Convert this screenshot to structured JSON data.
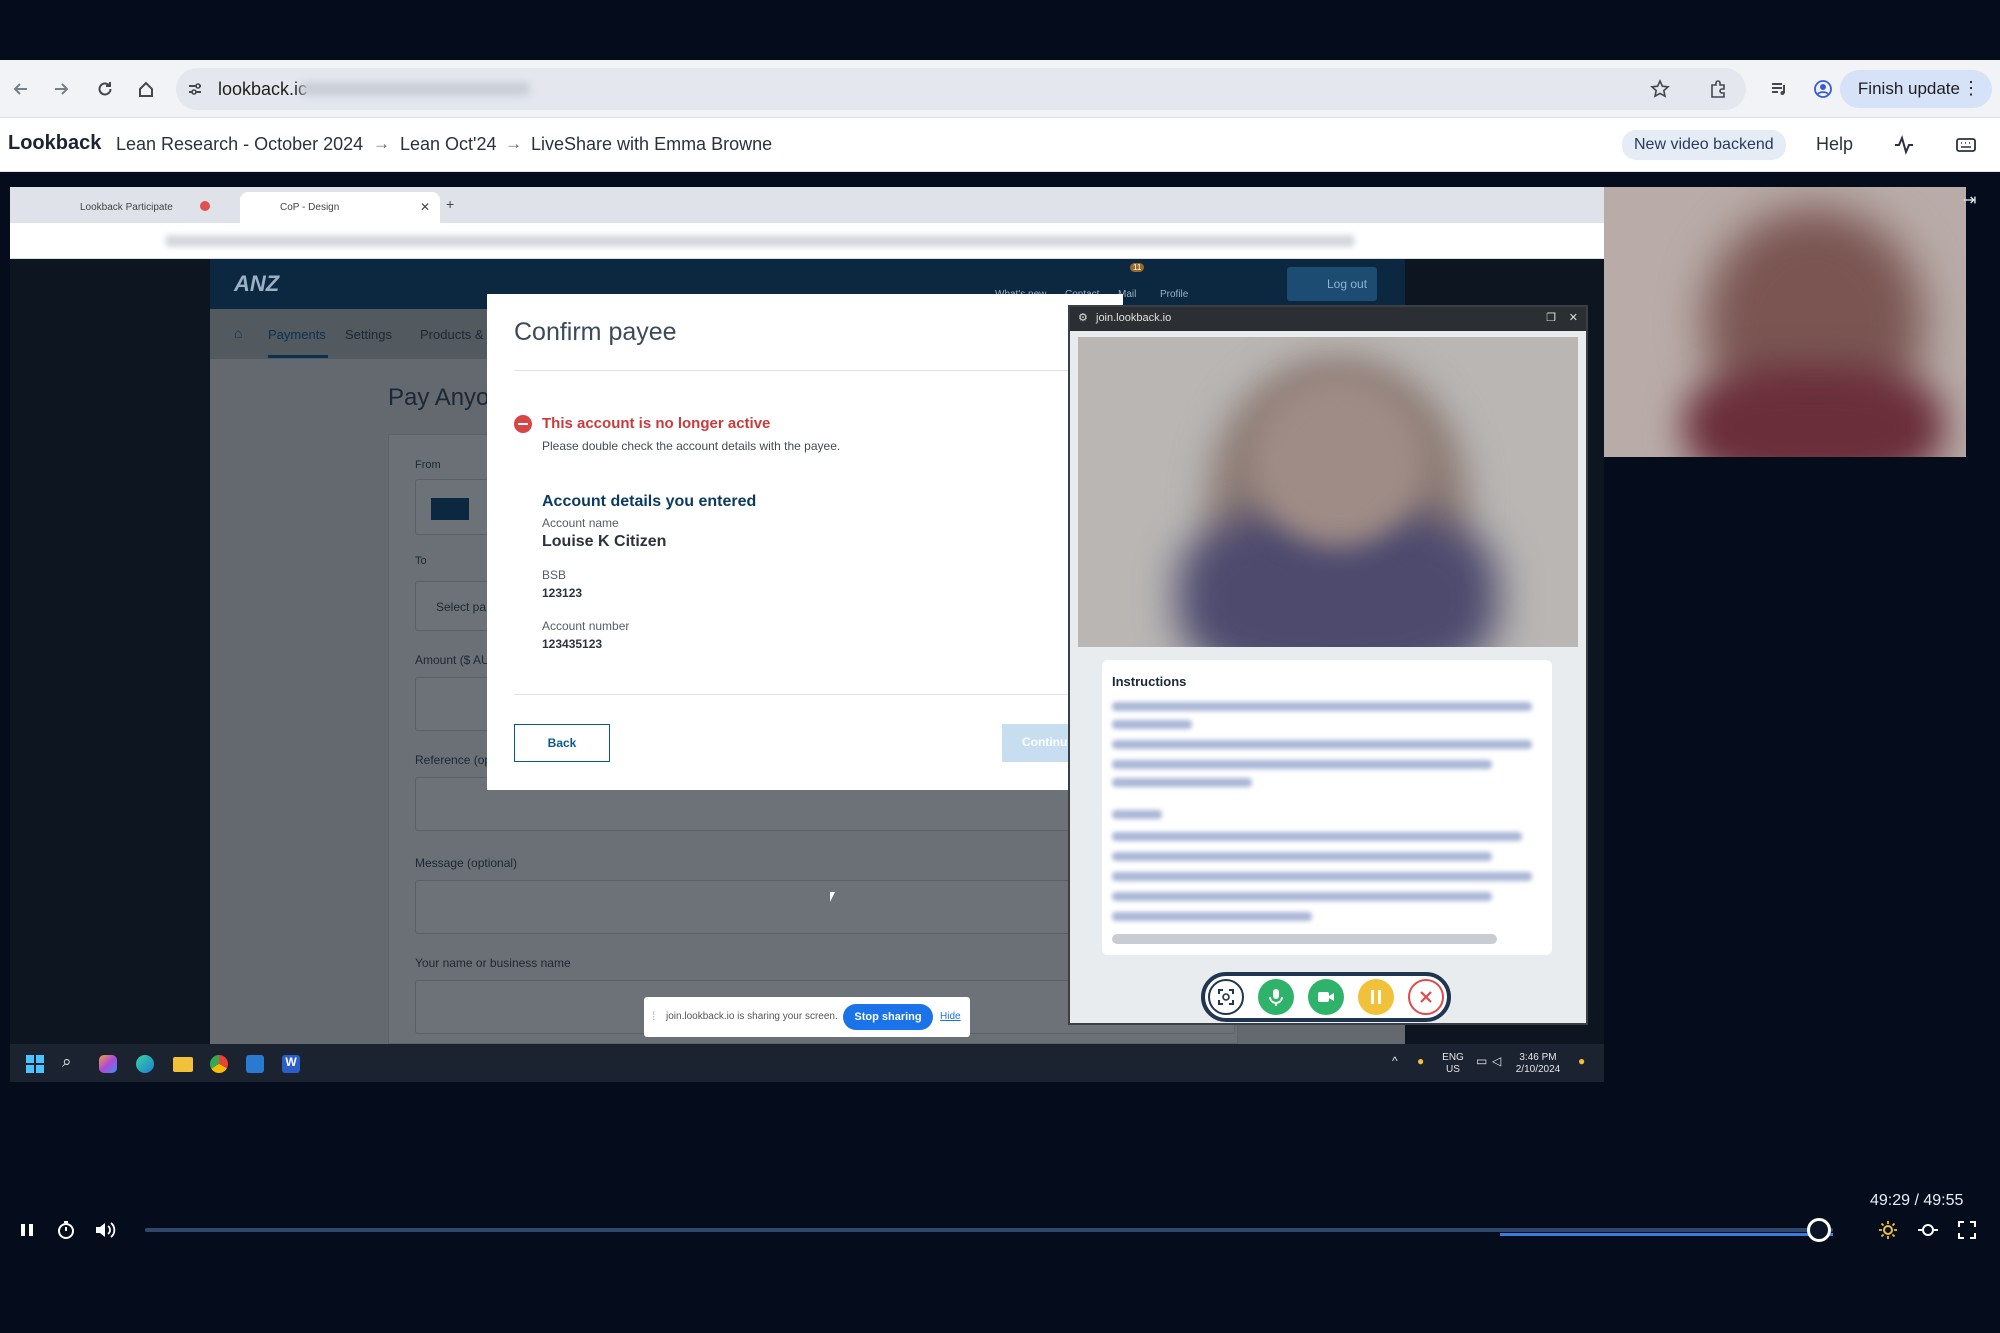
{
  "browser": {
    "url": "lookback.ic",
    "finish_update": "Finish update"
  },
  "app": {
    "brand": "Lookback",
    "breadcrumbs": [
      "Lean Research - October 2024",
      "Lean Oct'24",
      "LiveShare with Emma Browne"
    ],
    "new_backend": "New video backend",
    "help": "Help"
  },
  "shared_screen": {
    "tabs": [
      "Lookback Participate",
      "CoP - Design"
    ],
    "anz": {
      "logo": "ANZ",
      "nav": [
        "What's new",
        "Contact",
        "Mail",
        "Profile"
      ],
      "mail_badge": "11",
      "logout": "Log out",
      "subnav": [
        "Payments",
        "Settings",
        "Products &"
      ],
      "page_title": "Pay Anyor",
      "form": {
        "from_label": "From",
        "to_label": "To",
        "to_placeholder": "Select pa",
        "amount_label": "Amount ($ AU",
        "reference_label": "Reference (op",
        "message_label": "Message (optional)",
        "name_label": "Your name or business name"
      }
    },
    "modal": {
      "title": "Confirm payee",
      "error_title": "This account is no longer active",
      "error_body": "Please double check the account details with the payee.",
      "details_heading": "Account details you entered",
      "account_name_label": "Account name",
      "account_name": "Louise K Citizen",
      "bsb_label": "BSB",
      "bsb": "123123",
      "account_number_label": "Account number",
      "account_number": "123435123",
      "back": "Back",
      "continue": "Continu"
    },
    "lookback_panel": {
      "title": "join.lookback.io",
      "instructions_title": "Instructions"
    },
    "share_bar": {
      "text": "join.lookback.io is sharing your screen.",
      "stop": "Stop sharing",
      "hide": "Hide"
    },
    "taskbar": {
      "lang_top": "ENG",
      "lang_bottom": "US",
      "time": "3:46 PM",
      "date": "2/10/2024"
    }
  },
  "player": {
    "time": "49:29 / 49:55",
    "progress": 0.992
  },
  "colors": {
    "background": "#050d1c",
    "error": "#c83c3c",
    "anz_blue": "#0b2840",
    "stop_sharing": "#1a73e8"
  }
}
